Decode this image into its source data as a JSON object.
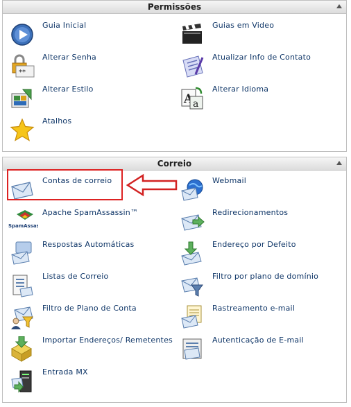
{
  "permissions": {
    "title": "Permissões",
    "items": [
      {
        "label": "Guia Inicial",
        "icon": "play-circle-icon"
      },
      {
        "label": "Guias em Video",
        "icon": "clapperboard-icon"
      },
      {
        "label": "Alterar Senha",
        "icon": "padlock-password-icon"
      },
      {
        "label": "Atualizar Info de Contato",
        "icon": "contact-card-icon"
      },
      {
        "label": "Alterar Estilo",
        "icon": "style-palette-icon"
      },
      {
        "label": "Alterar Idioma",
        "icon": "language-icon"
      },
      {
        "label": "Atalhos",
        "icon": "star-icon"
      }
    ]
  },
  "mail": {
    "title": "Correio",
    "items": [
      {
        "label": "Contas de correio",
        "icon": "envelope-icon"
      },
      {
        "label": "Webmail",
        "icon": "globe-mail-icon"
      },
      {
        "label": "Apache SpamAssassin™",
        "icon": "spamassassin-logo-icon",
        "logo_text": "SpamAssassin"
      },
      {
        "label": "Redirecionamentos",
        "icon": "forward-mail-icon"
      },
      {
        "label": "Respostas Automáticas",
        "icon": "auto-reply-icon"
      },
      {
        "label": "Endereço por Defeito",
        "icon": "default-address-icon"
      },
      {
        "label": "Listas de Correio",
        "icon": "mailing-list-icon"
      },
      {
        "label": "Filtro por plano de domínio",
        "icon": "domain-filter-icon"
      },
      {
        "label": "Filtro de Plano de Conta",
        "icon": "account-filter-icon"
      },
      {
        "label": "Rastreamento e-mail",
        "icon": "mail-tracking-icon"
      },
      {
        "label": "Importar Endereços/ Remetentes",
        "icon": "import-addresses-icon"
      },
      {
        "label": "Autenticação de E-mail",
        "icon": "mail-authentication-icon"
      },
      {
        "label": "Entrada MX",
        "icon": "mx-entry-icon"
      }
    ]
  },
  "annotation": {
    "highlight_color": "#d22222"
  }
}
